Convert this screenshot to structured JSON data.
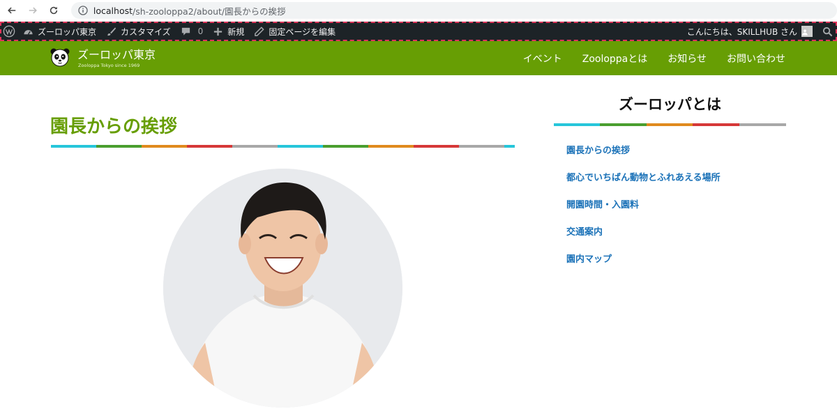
{
  "browser": {
    "url_host": "localhost",
    "url_path": "/sh-zooloppa2/about/園長からの挨拶"
  },
  "adminbar": {
    "site_name": "ズーロッパ東京",
    "customize": "カスタマイズ",
    "comments_count": "0",
    "new": "新規",
    "edit_page": "固定ページを編集",
    "greeting": "こんにちは、SKILLHUB さん"
  },
  "header": {
    "title": "ズーロッパ東京",
    "tagline": "Zooloppa Tokyo since 1969",
    "nav": [
      {
        "label": "イベント"
      },
      {
        "label": "Zooloppaとは"
      },
      {
        "label": "お知らせ"
      },
      {
        "label": "お問い合わせ"
      }
    ]
  },
  "main": {
    "title": "園長からの挨拶"
  },
  "sidebar": {
    "title": "ズーロッパとは",
    "items": [
      {
        "label": "園長からの挨拶"
      },
      {
        "label": "都心でいちばん動物とふれあえる場所"
      },
      {
        "label": "開園時間・入園料"
      },
      {
        "label": "交通案内"
      },
      {
        "label": "園内マップ"
      }
    ]
  },
  "colors": {
    "brand_green": "#679e04",
    "link_blue": "#1b72b8",
    "rainbow": [
      "#26c6da",
      "#4a9e2f",
      "#e08a1e",
      "#d63838",
      "#a8a8a8"
    ]
  }
}
